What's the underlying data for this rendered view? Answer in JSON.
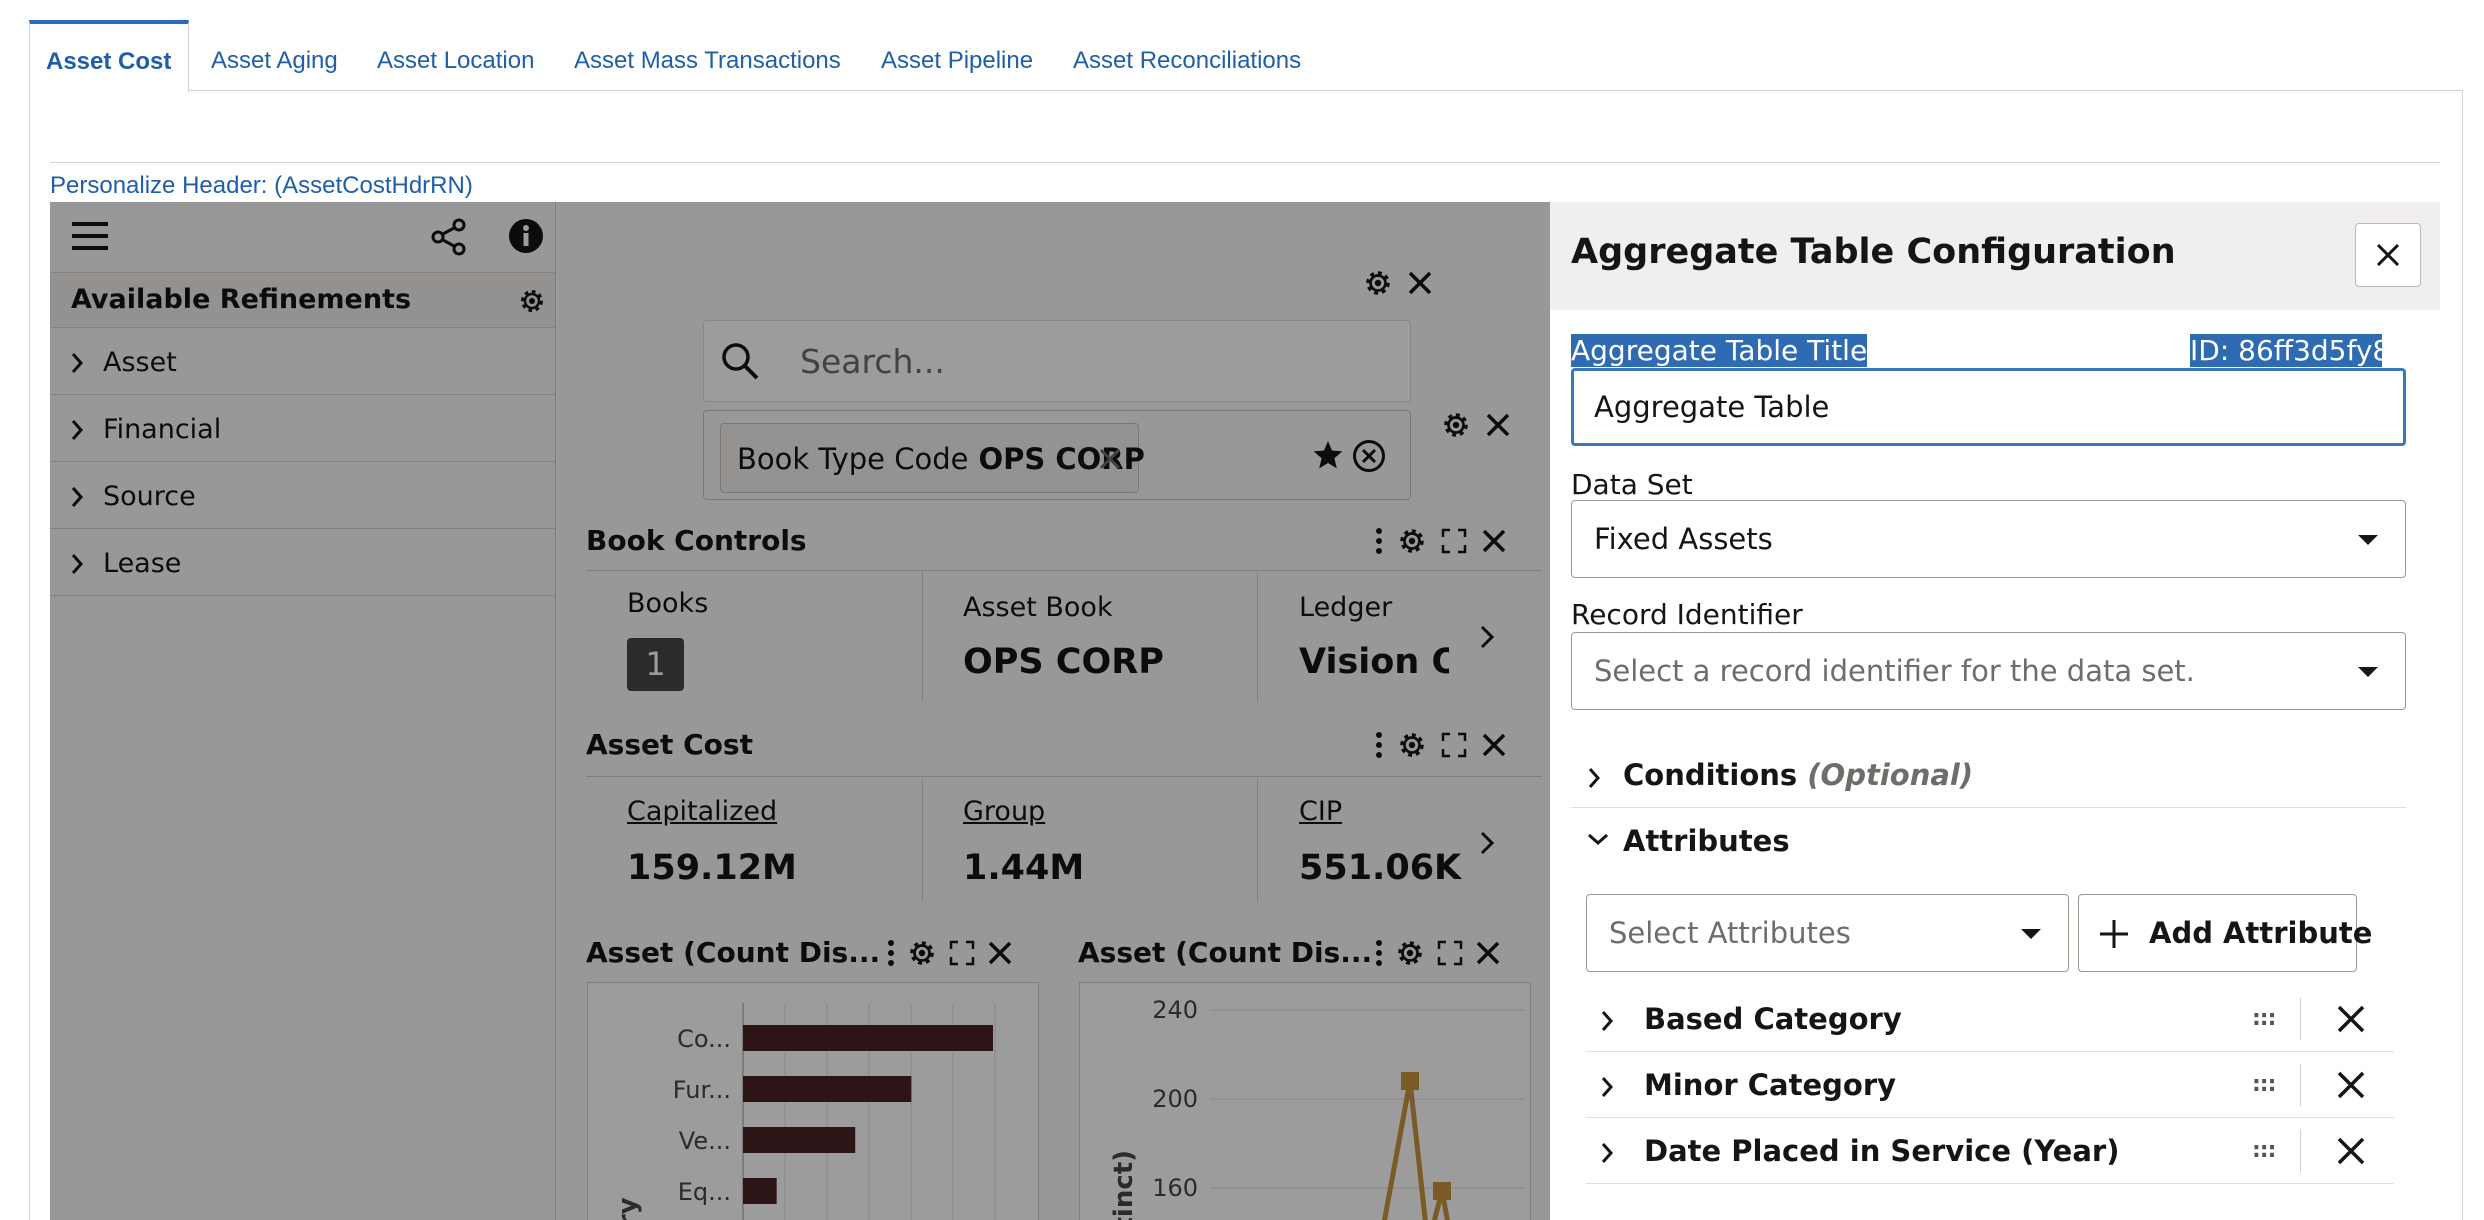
{
  "tabs": [
    {
      "label": "Asset Cost",
      "active": true
    },
    {
      "label": "Asset Aging"
    },
    {
      "label": "Asset Location"
    },
    {
      "label": "Asset Mass Transactions"
    },
    {
      "label": "Asset Pipeline"
    },
    {
      "label": "Asset Reconciliations"
    }
  ],
  "personalize_label": "Personalize Header: (AssetCostHdrRN)",
  "refinements": {
    "title": "Available Refinements",
    "items": [
      "Asset",
      "Financial",
      "Source",
      "Lease"
    ]
  },
  "search": {
    "placeholder": "Search..."
  },
  "filter_chip": {
    "label": "Book Type Code",
    "value": "OPS CORP"
  },
  "book_controls": {
    "title": "Book Controls",
    "cells": [
      {
        "label": "Books",
        "value": "1"
      },
      {
        "label": "Asset Book",
        "value": "OPS CORP"
      },
      {
        "label": "Ledger",
        "value": "Vision O"
      }
    ]
  },
  "asset_cost": {
    "title": "Asset Cost",
    "cells": [
      {
        "label": "Capitalized",
        "value": "159.12M"
      },
      {
        "label": "Group",
        "value": "1.44M"
      },
      {
        "label": "CIP",
        "value": "551.06K"
      }
    ]
  },
  "chart_data": [
    {
      "type": "bar",
      "title": "Asset (Count Dis...",
      "ylabel": "ory",
      "categories": [
        "Co...",
        "Fur...",
        "Ve...",
        "Eq..."
      ],
      "values": [
        245,
        165,
        110,
        33
      ],
      "color": "#4a2327"
    },
    {
      "type": "line",
      "title": "Asset (Count Dis...",
      "ylabel": "stinct)",
      "y_ticks": [
        "240",
        "200",
        "160"
      ],
      "ylim": [
        140,
        240
      ],
      "color": "#c8953f"
    }
  ],
  "config": {
    "title": "Aggregate Table Configuration",
    "title_label": "Aggregate Table Title",
    "id_label": "ID: 86ff3d5fy8",
    "title_value": "Aggregate Table",
    "dataset_label": "Data Set",
    "dataset_value": "Fixed Assets",
    "record_label": "Record Identifier",
    "record_placeholder": "Select a record identifier for the data set.",
    "conditions_label": "Conditions",
    "conditions_optional": "(Optional)",
    "attributes_label": "Attributes",
    "select_attributes_placeholder": "Select Attributes",
    "add_attribute_label": "Add Attribute",
    "attributes": [
      "Based Category",
      "Minor Category",
      "Date Placed in Service (Year)"
    ]
  },
  "colors": {
    "link": "#1f5ea8",
    "bar": "#4a2327",
    "line": "#c8953f",
    "selection": "#2f6bb3"
  }
}
